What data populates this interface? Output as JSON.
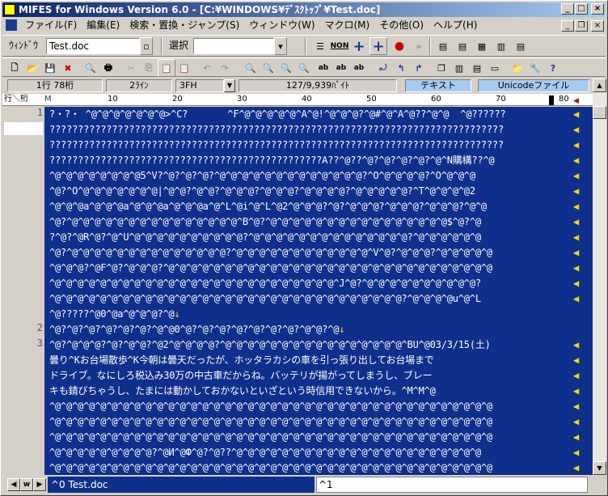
{
  "window": {
    "title": "MIFES for Windows Version 6.0 - [C:¥WINDOWS¥ﾃﾞｽｸﾄｯﾌﾟ¥Test.doc]"
  },
  "menu": [
    "ファイル(F)",
    "編集(E)",
    "検索・置換・ジャンプ(S)",
    "ウィンドウ(W)",
    "マクロ(M)",
    "その他(O)",
    "ヘルプ(H)"
  ],
  "toolbar": {
    "window_label": "ｳｨﾝﾄﾞｳ",
    "window_value": "Test.doc",
    "select_label": "選択",
    "non_label": "NON"
  },
  "status": {
    "position": "1行  78桁",
    "lines": "2ﾗｲﾝ",
    "fh": "3FH",
    "bytes": "127/9,939ﾊﾞｲﾄ",
    "mode": "テキスト",
    "encoding": "Unicodeファイル"
  },
  "ruler": {
    "label": "行＼桁",
    "m": "M",
    "numbers": [
      "10",
      "20",
      "30",
      "40",
      "50",
      "60",
      "70",
      "80"
    ]
  },
  "gutter": {
    "line_numbers": [
      "1",
      "2",
      "3"
    ]
  },
  "editor": {
    "lines": [
      "?・?・ ^@^@^@^@^@^@^@>^C?       ^F^@^@^@^@^@^A^@!^@^@^@?^@#^@^A^@??^@^@  ^@??????",
      "????????????????????????????????????????????????????????????????????????????????",
      "????????????????????????????????????????????????????????????????????????????????",
      "????????????????????????????????????????????????A??^@??^@?^@?^@?^@?^@^N購構??^@",
      "^@^@^@^@^@^@^@^@5^V?^@?^@?^@?^@^@^@^@^@^@^@^@^@^@^@^@^@?^O^@^@^@^@?^O^@^@^@",
      "^@?^O^@^@^@^@^@^@^@|^@^@?^@^@?^@^@^@?^@^@^@?^@^@^@^@?^@^@^@^@^@?^T^@^@^@^@2",
      "^@^@^@a^@^@^@a^@^@^@a^@^@^@a^@^L^@i^@^L^@2^@^@^@?^@?^@^@^@?^@^@^@?^@^@^@?^@^@",
      "^@?^@^@^@^@^@^@^@^@^@^@^@^@^@^@^@^B^@?^@^@^@^@^@^@^@^@^@^@^@^@^@^@^@^@$^@?^@",
      "?^@?^@R^@?^@^U^@^@^@^@^@^@^@^@^@^@?^@^@^@^@^@^@^@^@^@^@^@^@^@^@?^@^@^@^@^@^@",
      "^@?^@^@^@^@^@^@^@^@^@^@^@^@^@^@?^@^@^@^@^@^@^@^@^@^@^@^@^V^@?^@^@^@?^@^@^@^@^@",
      "^@^@^@?^@F^@?^@^@^@?^@^@^@^@^@^@^@^@^@^@^@^@^@^@^@^@^@^@^@^@^@^@^@^@^@^@^@^@^@",
      "^@^@^@^@^@^@^@^@^@^@^@^@^@^@^@^@^@^@^@^@^@^@^@^@^@^J^@?^@^@^@^@^@^@^@^@^@^@?",
      "^@^@^@^@^@^@^@^@^@^@^@^@^@^@^@^@^@^@^@^@^@^@^@^@^@^@^@^@^@^@^@?^@^@^@^@u^@^L",
      "^@?????^@0^@a^@^@^@?^@",
      "^@?^@?^@?^@?^@?^@?^@^@0^@?^@?^@?^@?^@?^@?^@?^@^@?^@",
      "^@?^@^@^@?^@?^@^@?^@2^@^@^@^@?^@^@^@^@^@^@^@^@^@^@^@^@^@^@^@^@^BU^@03/3/15(土)",
      "曇り^Kお台場散歩^K今朝は曇天だったが、ホッタラカシの車を引っ張り出してお台場まで",
      "ドライブ。なにしろ税込み30万の中古車だからね。バッテリが揚がってしまうし、ブレー",
      "キも錆びちゃうし、たまには動かしておかないといざという時信用できないから。^M^M^@",
      "^@^@^@^@^@^@^@^@^@^@^@^@^@^@^@^@^@^@^@^@^@^@^@^@^@^@^@^@^@^@^@^@^@^@^@^@^@^@^@",
      "^@^@^@^@^@^@^@^@^@^@^@^@^@^@^@^@^@^@^@^@^@^@^@^@^@^@^@^@^@^@^@^@^@^@^@^@^@^@^@",
      "^@^@^@^@^@^@^@^@^@^@^@^@^@^@^@^@^@^@^@^@^@^@^@^@^@^@^@^@^@^@^@^@^@^@^@^@^@^@^@",
      "^@^@^@^@^@^@^@^@^@?^@И^@Ф^@?^@??^@^@^@^@^@^@^@^@^@^@^@^@^@^@^@^@^@^@^@^@^@^@",
      "^@^@^@^@^@^@^@^@^@^@^@^@^@^@^@^@^@^@^@^@^@^@^@^@^@^@^@^@^@^@^@^@^@^@^@^@^@^@^@"
    ],
    "eol_mark": "◀",
    "newline_mark": "↓"
  },
  "tabs": {
    "doc": "^0 Test.doc",
    "other": "^1"
  },
  "colors": {
    "editor_bg": "#0f2f8c",
    "eol": "#ffd800",
    "title_start": "#0a246a",
    "title_end": "#a6caf0"
  }
}
